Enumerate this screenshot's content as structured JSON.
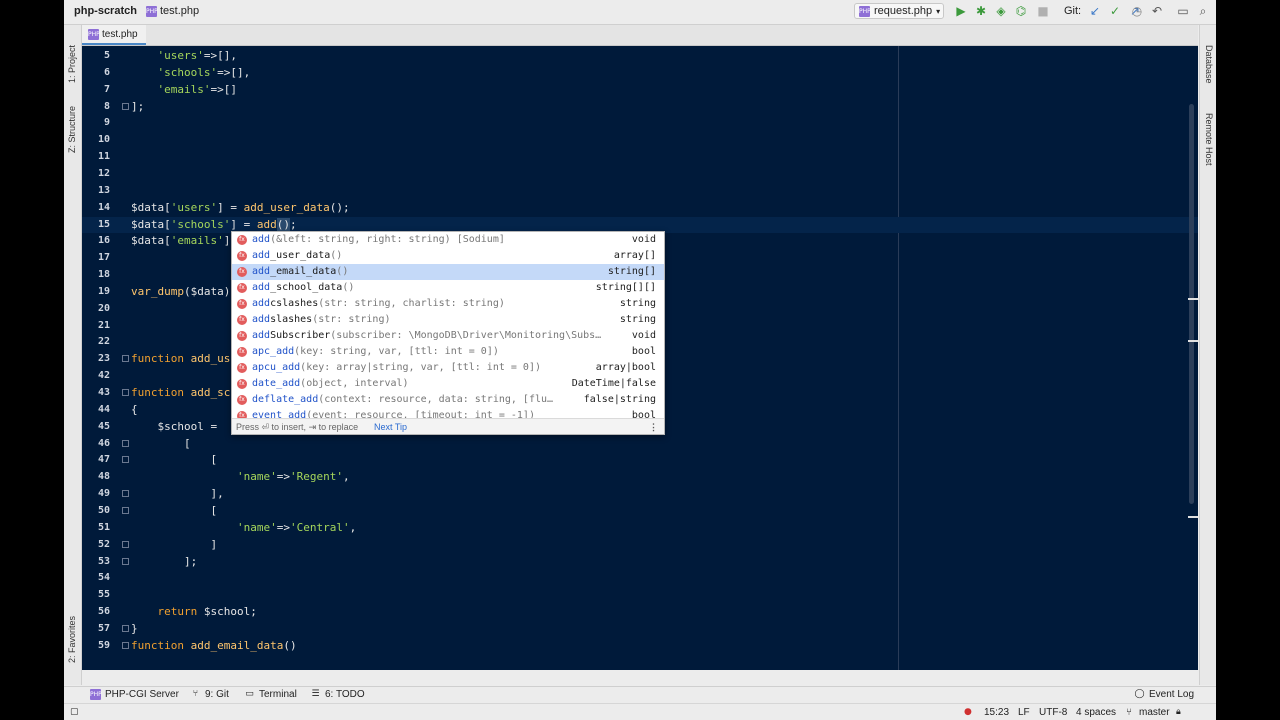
{
  "navbar": {
    "project": "php-scratch",
    "file": "test.php",
    "run_config": "request.php",
    "git_label": "Git:"
  },
  "tabs": [
    {
      "label": "test.php",
      "icon": "php-file-icon"
    }
  ],
  "left_stripe": {
    "project": "1: Project",
    "structure": "Z: Structure",
    "favorites": "2: Favorites"
  },
  "right_stripe": {
    "database": "Database",
    "remote_host": "Remote Host"
  },
  "editor": {
    "lines": [
      {
        "n": "5",
        "html": "    <span class=\"c-str\">'users'</span>=>[],"
      },
      {
        "n": "6",
        "html": "    <span class=\"c-str\">'schools'</span>=>[],"
      },
      {
        "n": "7",
        "html": "    <span class=\"c-str\">'emails'</span>=>[]"
      },
      {
        "n": "8",
        "html": "];"
      },
      {
        "n": "9",
        "html": ""
      },
      {
        "n": "10",
        "html": ""
      },
      {
        "n": "11",
        "html": ""
      },
      {
        "n": "12",
        "html": ""
      },
      {
        "n": "13",
        "html": ""
      },
      {
        "n": "14",
        "html": "$data[<span class=\"c-str\">'users'</span>] = <span class=\"c-fn\">add_user_data</span>();"
      },
      {
        "n": "15",
        "html": "$data[<span class=\"c-str\">'schools'</span>] = <span class=\"c-fn\">add</span><span class=\"c-paren-hl\">()</span>;"
      },
      {
        "n": "16",
        "html": "$data[<span class=\"c-str\">'emails'</span>]"
      },
      {
        "n": "17",
        "html": ""
      },
      {
        "n": "18",
        "html": ""
      },
      {
        "n": "19",
        "html": "<span class=\"c-fn\">var_dump</span>($data);"
      },
      {
        "n": "20",
        "html": ""
      },
      {
        "n": "21",
        "html": ""
      },
      {
        "n": "22",
        "html": ""
      },
      {
        "n": "23",
        "html": "<span class=\"c-kw\">function</span> <span class=\"c-fn\">add_use</span>"
      },
      {
        "n": "42",
        "html": ""
      },
      {
        "n": "43",
        "html": "<span class=\"c-kw\">function</span> <span class=\"c-fn\">add_sch</span>"
      },
      {
        "n": "44",
        "html": "{"
      },
      {
        "n": "45",
        "html": "    $school ="
      },
      {
        "n": "46",
        "html": "        ["
      },
      {
        "n": "47",
        "html": "            ["
      },
      {
        "n": "48",
        "html": "                <span class=\"c-str\">'name'</span>=><span class=\"c-str\">'Regent'</span>,"
      },
      {
        "n": "49",
        "html": "            ],"
      },
      {
        "n": "50",
        "html": "            ["
      },
      {
        "n": "51",
        "html": "                <span class=\"c-str\">'name'</span>=><span class=\"c-str\">'Central'</span>,"
      },
      {
        "n": "52",
        "html": "            ]"
      },
      {
        "n": "53",
        "html": "        ];"
      },
      {
        "n": "54",
        "html": ""
      },
      {
        "n": "55",
        "html": ""
      },
      {
        "n": "56",
        "html": "    <span class=\"c-kw\">return</span> $school;"
      },
      {
        "n": "57",
        "html": "}"
      },
      {
        "n": "59",
        "html": "<span class=\"c-kw\">function</span> <span class=\"c-fn\">add_email_data</span>()"
      }
    ],
    "current_line": "15"
  },
  "completion": {
    "items": [
      {
        "match": "add",
        "rest": "",
        "params": "(&left: string, right: string) [Sodium]",
        "type": "void"
      },
      {
        "match": "add",
        "rest": "_user_data",
        "params": "()",
        "type": "array[]"
      },
      {
        "match": "add",
        "rest": "_email_data",
        "params": "()",
        "type": "string[]",
        "selected": true
      },
      {
        "match": "add",
        "rest": "_school_data",
        "params": "()",
        "type": "string[][]"
      },
      {
        "match": "add",
        "rest": "cslashes",
        "params": "(str: string, charlist: string)",
        "type": "string"
      },
      {
        "match": "add",
        "rest": "slashes",
        "params": "(str: string)",
        "type": "string"
      },
      {
        "match": "add",
        "rest": "Subscriber",
        "params": "(subscriber: \\MongoDB\\Driver\\Monitoring\\Subs…",
        "type": "void"
      },
      {
        "match": "apc_add",
        "rest": "",
        "params": "(key: string, var, [ttl: int = 0])",
        "type": "bool"
      },
      {
        "match": "apcu_add",
        "rest": "",
        "params": "(key: array|string, var, [ttl: int = 0])",
        "type": "array|bool"
      },
      {
        "match": "date_add",
        "rest": "",
        "params": "(object, interval)",
        "type": "DateTime|false"
      },
      {
        "match": "deflate_add",
        "rest": "",
        "params": "(context: resource, data: string, [flu…",
        "type": "false|string"
      },
      {
        "match": "event_add",
        "rest": "",
        "params": "(event: resource, [timeout: int = -1])",
        "type": "bool"
      }
    ],
    "footer_hint": "Press ⏎ to insert, ⇥ to replace",
    "footer_next": "Next Tip"
  },
  "tool_windows": {
    "server": "PHP-CGI Server",
    "git": "9: Git",
    "terminal": "Terminal",
    "todo": "6: TODO",
    "event_log": "Event Log"
  },
  "status": {
    "position": "15:23",
    "line_sep": "LF",
    "encoding": "UTF-8",
    "indent": "4 spaces",
    "branch": "master"
  }
}
